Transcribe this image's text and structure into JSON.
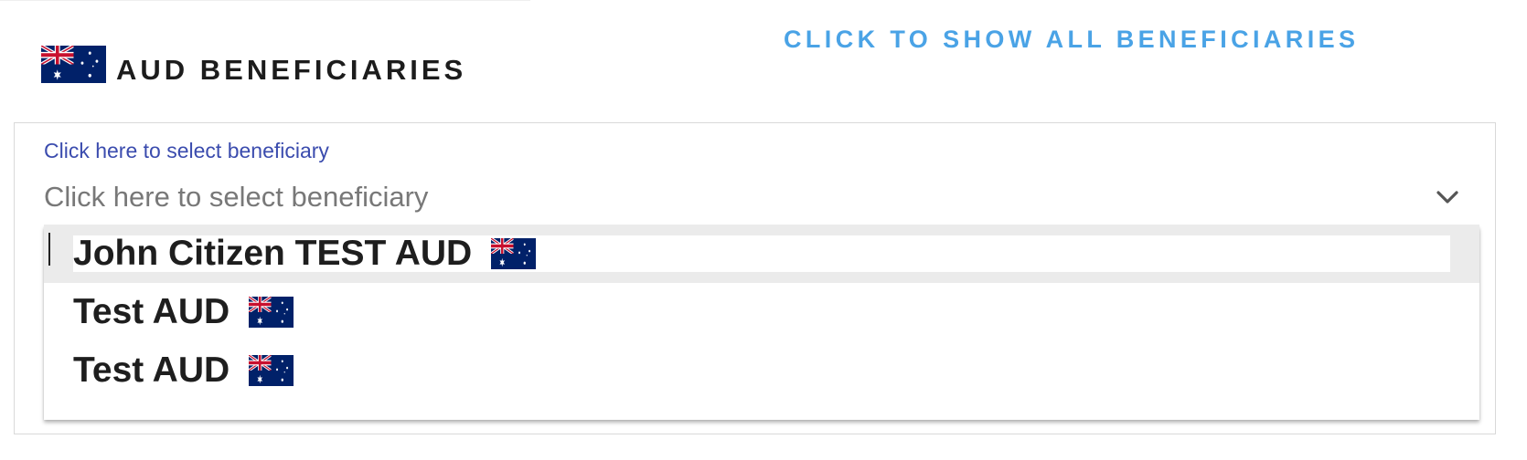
{
  "header": {
    "title": "AUD BENEFICIARIES",
    "flag_icon": "australia-flag-icon",
    "show_all_link": "CLICK TO SHOW ALL BENEFICIARIES"
  },
  "select": {
    "label": "Click here to select beneficiary",
    "placeholder": "Click here to select beneficiary",
    "chevron_icon": "chevron-down-icon"
  },
  "dropdown": {
    "options": [
      {
        "label": "John Citizen TEST AUD",
        "flag_icon": "australia-flag-icon",
        "highlighted": true
      },
      {
        "label": "Test AUD",
        "flag_icon": "australia-flag-icon",
        "highlighted": false
      },
      {
        "label": "Test AUD",
        "flag_icon": "australia-flag-icon",
        "highlighted": false
      }
    ]
  },
  "colors": {
    "link": "#4aa3e6",
    "label": "#3b4cae",
    "placeholder": "#787878",
    "highlight": "#ebebeb",
    "flag_blue": "#012169",
    "flag_red": "#c8102e"
  }
}
